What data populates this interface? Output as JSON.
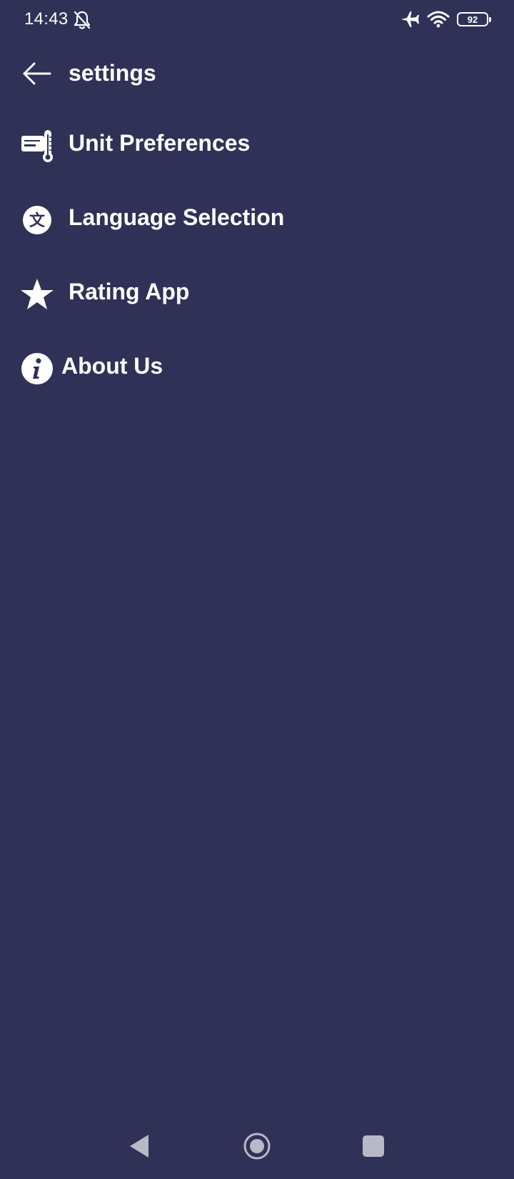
{
  "status_bar": {
    "time": "14:43",
    "mute_icon": "bell-off-icon",
    "airplane_icon": "airplane-icon",
    "wifi_icon": "wifi-icon",
    "battery_level": "92"
  },
  "app_bar": {
    "back_icon": "arrow-left-icon",
    "title": "settings"
  },
  "menu": {
    "items": [
      {
        "label": "Unit Preferences",
        "icon": "unit-thermometer-icon"
      },
      {
        "label": "Language Selection",
        "icon": "language-icon"
      },
      {
        "label": "Rating App",
        "icon": "star-icon"
      },
      {
        "label": "About Us",
        "icon": "info-icon"
      }
    ]
  },
  "nav_bar": {
    "back": "nav-back-icon",
    "home": "nav-home-icon",
    "recents": "nav-recents-icon"
  },
  "colors": {
    "background": "#2f3157",
    "foreground": "#ffffff",
    "nav_icon": "#b8b8c8"
  }
}
